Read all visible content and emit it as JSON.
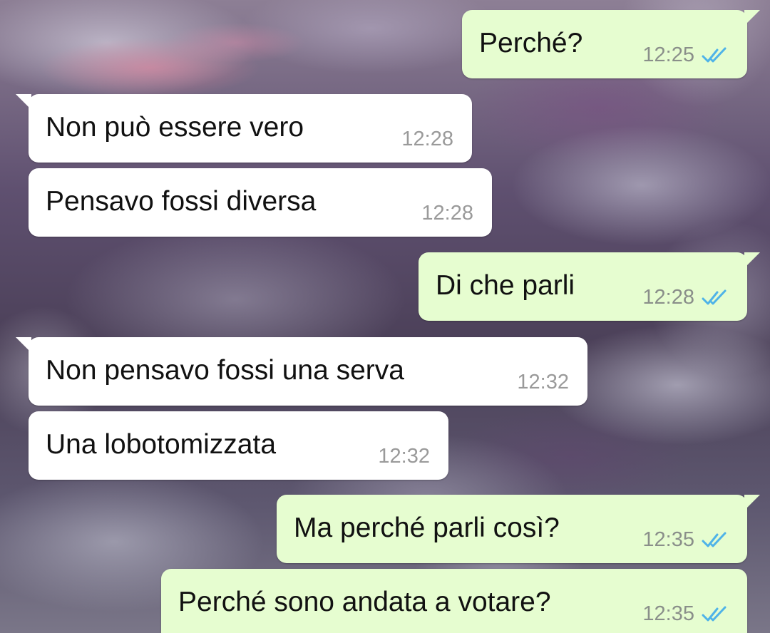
{
  "colors": {
    "outgoing_bubble": "#e6fdd0",
    "incoming_bubble": "#ffffff",
    "read_check": "#4fb3e8",
    "timestamp": "#8a8f8a"
  },
  "messages": [
    {
      "direction": "outgoing",
      "text": "Perché?",
      "time": "12:25",
      "status": "read",
      "status_icon": "double-check-icon"
    },
    {
      "direction": "incoming",
      "text": "Non può essere vero",
      "time": "12:28"
    },
    {
      "direction": "incoming",
      "text": "Pensavo fossi diversa",
      "time": "12:28"
    },
    {
      "direction": "outgoing",
      "text": "Di che parli",
      "time": "12:28",
      "status": "read",
      "status_icon": "double-check-icon"
    },
    {
      "direction": "incoming",
      "text": "Non pensavo fossi una serva",
      "time": "12:32"
    },
    {
      "direction": "incoming",
      "text": "Una lobotomizzata",
      "time": "12:32"
    },
    {
      "direction": "outgoing",
      "text": "Ma perché parli così?",
      "time": "12:35",
      "status": "read",
      "status_icon": "double-check-icon"
    },
    {
      "direction": "outgoing",
      "text": "Perché sono andata a votare?",
      "time": "12:35",
      "status": "read",
      "status_icon": "double-check-icon"
    }
  ]
}
